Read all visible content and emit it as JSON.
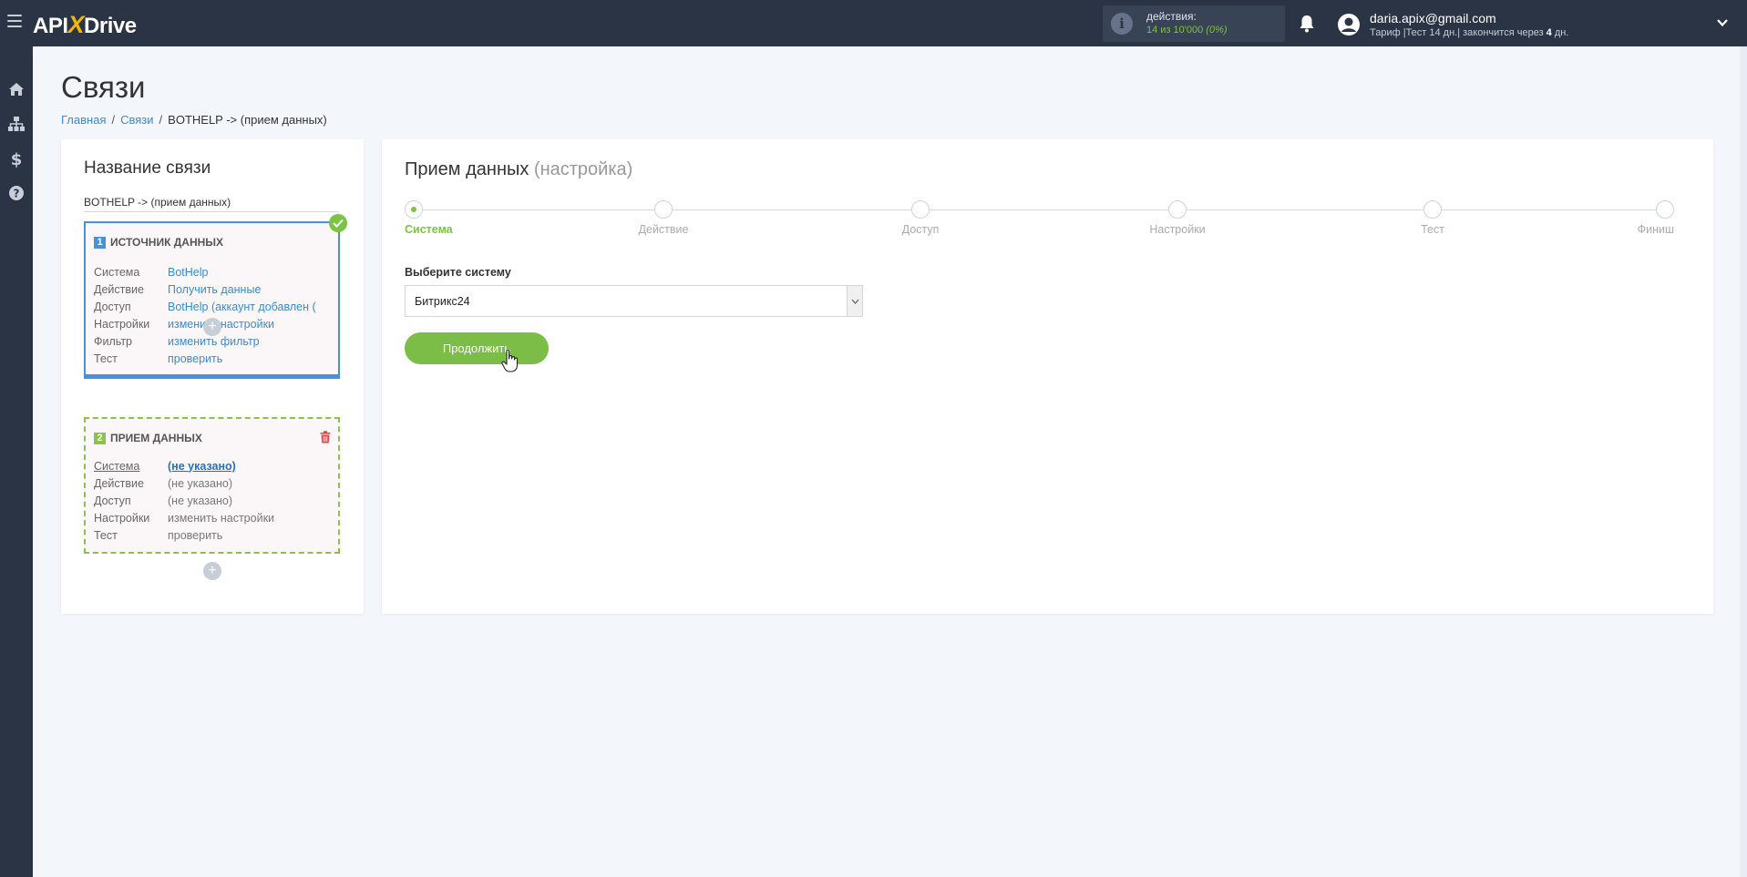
{
  "header": {
    "logo": {
      "left": "API",
      "x": "X",
      "right": "Drive"
    },
    "actions_label": "действия:",
    "actions_count": "14 из 10'000",
    "actions_pct": "(0%)",
    "user_email": "daria.apix@gmail.com",
    "tariff_prefix": "Тариф |Тест 14 дн.| закончится через ",
    "tariff_days": "4",
    "tariff_suffix": " дн."
  },
  "sidebar": {
    "items": [
      {
        "icon": "home-icon"
      },
      {
        "icon": "sitemap-icon"
      },
      {
        "icon": "dollar-icon"
      },
      {
        "icon": "help-icon"
      }
    ]
  },
  "page": {
    "title": "Связи",
    "breadcrumb": [
      "Главная",
      "Связи",
      "BOTHELP -> (прием данных)"
    ]
  },
  "connection": {
    "title": "Название связи",
    "name_value": "BOTHELP -> (прием данных)",
    "source": {
      "number": "1",
      "title": "ИСТОЧНИК ДАННЫХ",
      "rows": [
        {
          "key": "Система",
          "value": "BotHelp"
        },
        {
          "key": "Действие",
          "value": "Получить данные"
        },
        {
          "key": "Доступ",
          "value": "BotHelp (аккаунт добавлен ("
        },
        {
          "key": "Настройки",
          "value": "изменить настройки"
        },
        {
          "key": "Фильтр",
          "value": "изменить фильтр"
        },
        {
          "key": "Тест",
          "value": "проверить"
        }
      ]
    },
    "receiver": {
      "number": "2",
      "title": "ПРИЕМ ДАННЫХ",
      "rows": [
        {
          "key": "Система",
          "value": "(не указано)"
        },
        {
          "key": "Действие",
          "value": "(не указано)"
        },
        {
          "key": "Доступ",
          "value": "(не указано)"
        },
        {
          "key": "Настройки",
          "value": "изменить настройки"
        },
        {
          "key": "Тест",
          "value": "проверить"
        }
      ]
    },
    "add_symbol": "+"
  },
  "setup": {
    "title": "Прием данных",
    "subtitle": "(настройка)",
    "steps": [
      "Система",
      "Действие",
      "Доступ",
      "Настройки",
      "Тест",
      "Финиш"
    ],
    "active_step": 0,
    "select_label": "Выберите систему",
    "select_value": "Битрикс24",
    "continue_label": "Продолжить"
  },
  "colors": {
    "topbar": "#2b3445",
    "accent_green": "#7cc243",
    "accent_blue": "#4a90d9",
    "link": "#3a8bd0",
    "logo_x": "#f5b400"
  }
}
